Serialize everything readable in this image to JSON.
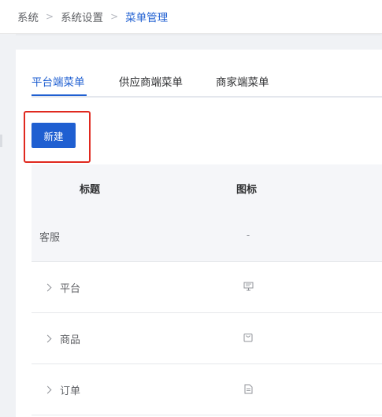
{
  "breadcrumb": {
    "items": [
      "系统",
      "系统设置",
      "菜单管理"
    ]
  },
  "tabs": [
    "平台端菜单",
    "供应商端菜单",
    "商家端菜单"
  ],
  "toolbar": {
    "new_label": "新建"
  },
  "table": {
    "headers": {
      "title": "标题",
      "icon": "图标"
    },
    "rows": [
      {
        "title": "客服",
        "icon_text": "-",
        "expandable": false,
        "icon": ""
      },
      {
        "title": "平台",
        "icon_text": "",
        "expandable": true,
        "icon": "monitor-icon"
      },
      {
        "title": "商品",
        "icon_text": "",
        "expandable": true,
        "icon": "shopping-bag-icon"
      },
      {
        "title": "订单",
        "icon_text": "",
        "expandable": true,
        "icon": "document-icon"
      }
    ]
  },
  "colors": {
    "accent": "#1f5fd1",
    "highlight": "#e0291f",
    "header_bg": "#f5f6f9"
  }
}
